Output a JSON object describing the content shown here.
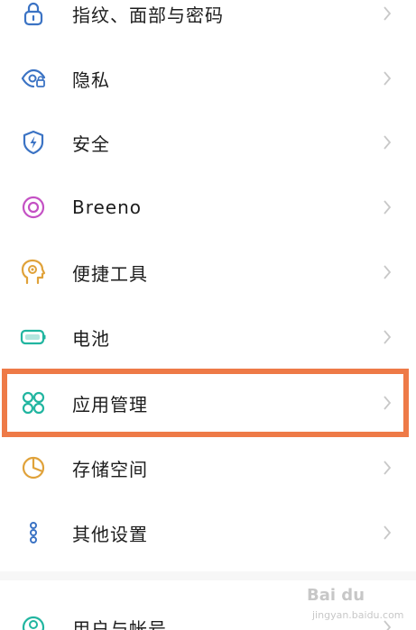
{
  "settings": {
    "items": [
      {
        "label": "指纹、面部与密码",
        "icon": "lock-icon",
        "color": "#3b73c4"
      },
      {
        "label": "隐私",
        "icon": "privacy-eye-icon",
        "color": "#3b73c4"
      },
      {
        "label": "安全",
        "icon": "shield-bolt-icon",
        "color": "#3b73c4"
      },
      {
        "label": "Breeno",
        "icon": "breeno-ring-icon",
        "color": "#c451c4"
      },
      {
        "label": "便捷工具",
        "icon": "head-gear-icon",
        "color": "#e0a23a"
      },
      {
        "label": "电池",
        "icon": "battery-icon",
        "color": "#21b5a0"
      },
      {
        "label": "应用管理",
        "icon": "apps-grid-icon",
        "color": "#21b5a0"
      },
      {
        "label": "存储空间",
        "icon": "pie-storage-icon",
        "color": "#e0a23a"
      },
      {
        "label": "其他设置",
        "icon": "more-dots-icon",
        "color": "#3b73c4"
      },
      {
        "label": "用户与帐号",
        "icon": "user-icon",
        "color": "#21b5a0"
      }
    ],
    "highlighted_label": "应用管理"
  },
  "watermark": {
    "text": "Bai du",
    "sub": "jingyan.baidu.com"
  },
  "colors": {
    "highlight_border": "#ee7a47",
    "text": "#1d1d1d",
    "chevron": "#c8c8c8"
  }
}
